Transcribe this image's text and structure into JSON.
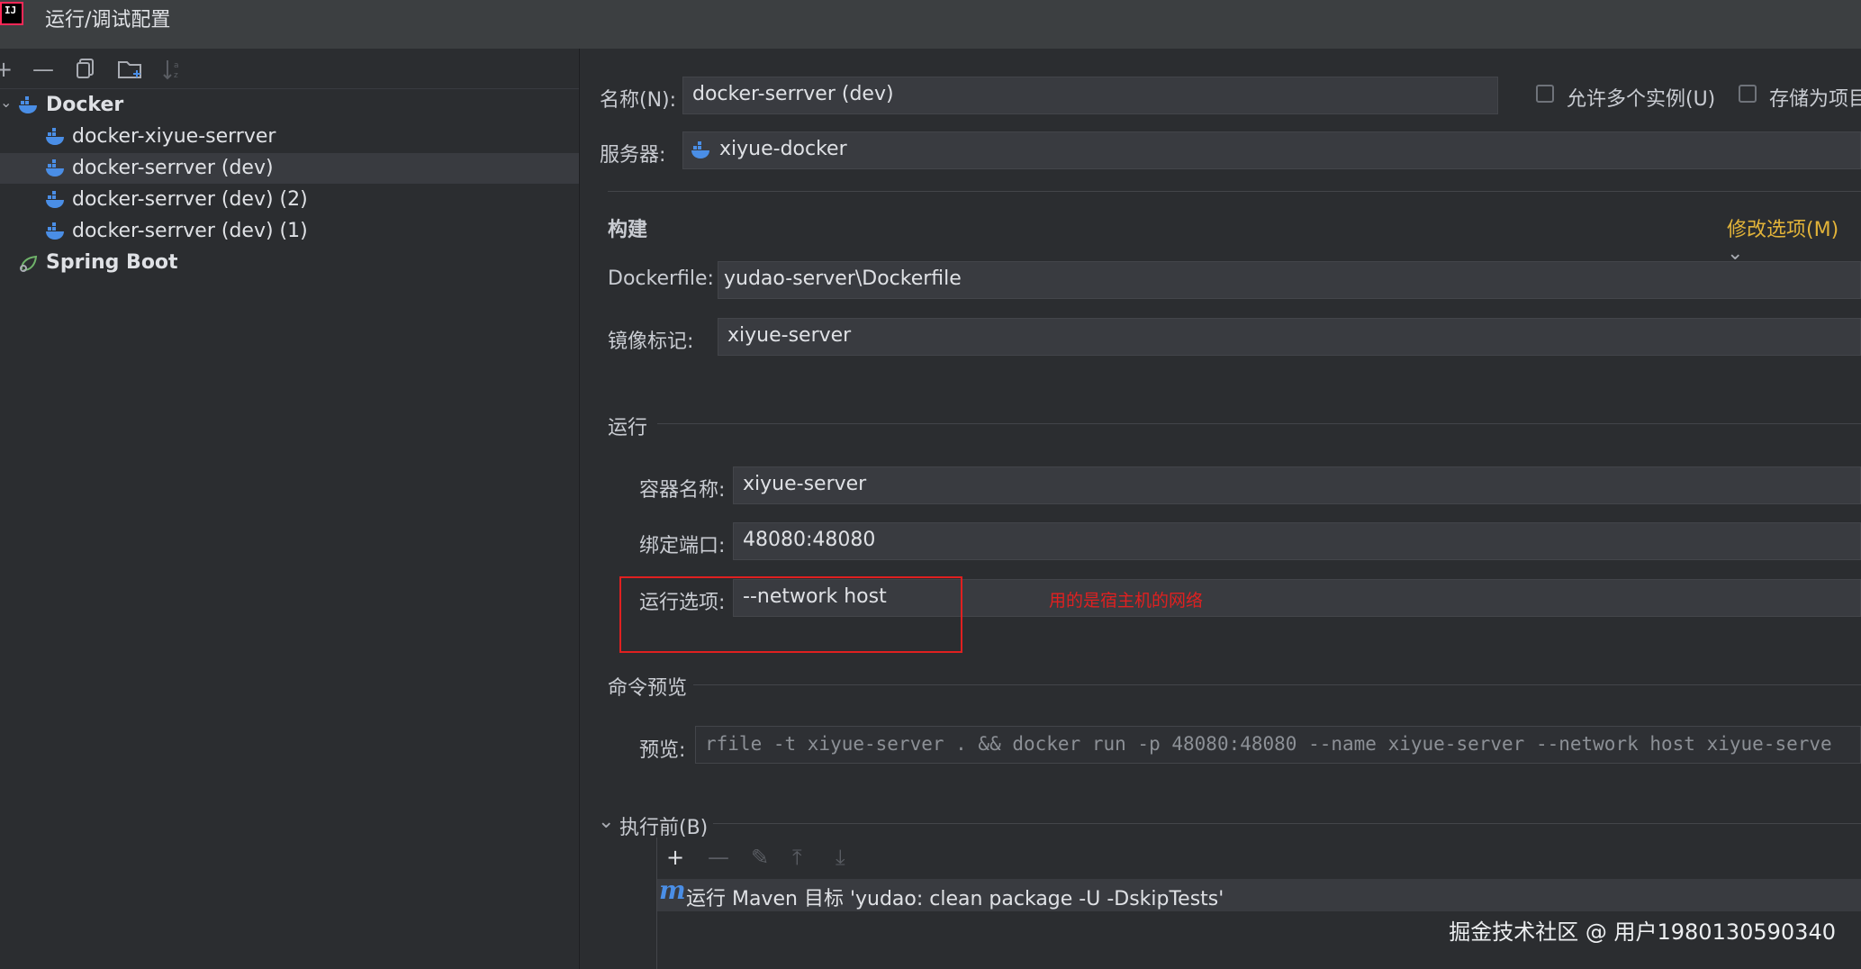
{
  "window": {
    "title": "运行/调试配置",
    "logo_text": "IJ"
  },
  "toolbar": {
    "add": "+",
    "remove": "—",
    "copy": "⧉",
    "new_folder": "📁",
    "sort": "↓"
  },
  "tree": {
    "groups": [
      {
        "label": "Docker",
        "icon": "docker-icon",
        "items": [
          {
            "label": "docker-xiyue-serrver",
            "icon": "docker-icon"
          },
          {
            "label": "docker-serrver (dev)",
            "icon": "docker-icon",
            "selected": true
          },
          {
            "label": "docker-serrver (dev) (2)",
            "icon": "docker-icon"
          },
          {
            "label": "docker-serrver (dev) (1)",
            "icon": "docker-icon"
          }
        ]
      },
      {
        "label": "Spring Boot",
        "icon": "spring-boot-icon",
        "items": []
      }
    ]
  },
  "form": {
    "name_label": "名称(N):",
    "name_value": "docker-serrver (dev)",
    "allow_multiple_label": "允许多个实例(U)",
    "store_as_project_label": "存储为项目",
    "server_label": "服务器:",
    "server_value": "xiyue-docker",
    "build": {
      "section": "构建",
      "modify_options": "修改选项(M)",
      "dockerfile_label": "Dockerfile:",
      "dockerfile_value": "yudao-server\\Dockerfile",
      "image_tag_label": "镜像标记:",
      "image_tag_value": "xiyue-server"
    },
    "run": {
      "section": "运行",
      "container_label": "容器名称:",
      "container_value": "xiyue-server",
      "ports_label": "绑定端口:",
      "ports_value": "48080:48080",
      "options_label": "运行选项:",
      "options_value": "--network host"
    },
    "preview": {
      "section": "命令预览",
      "label": "预览:",
      "value": "rfile -t xiyue-server . && docker run -p 48080:48080 --name xiyue-server --network host xiyue-serve"
    },
    "before": {
      "section": "执行前(B)",
      "task": "运行 Maven 目标 'yudao: clean package -U -DskipTests'"
    }
  },
  "annotation": {
    "text": "用的是宿主机的网络",
    "color": "#e02020"
  },
  "watermark": "掘金技术社区 @ 用户1980130590340",
  "colors": {
    "background": "#2b2d30",
    "field": "#393b40",
    "accent_docker": "#4a8ee6",
    "link": "#e2b339"
  }
}
